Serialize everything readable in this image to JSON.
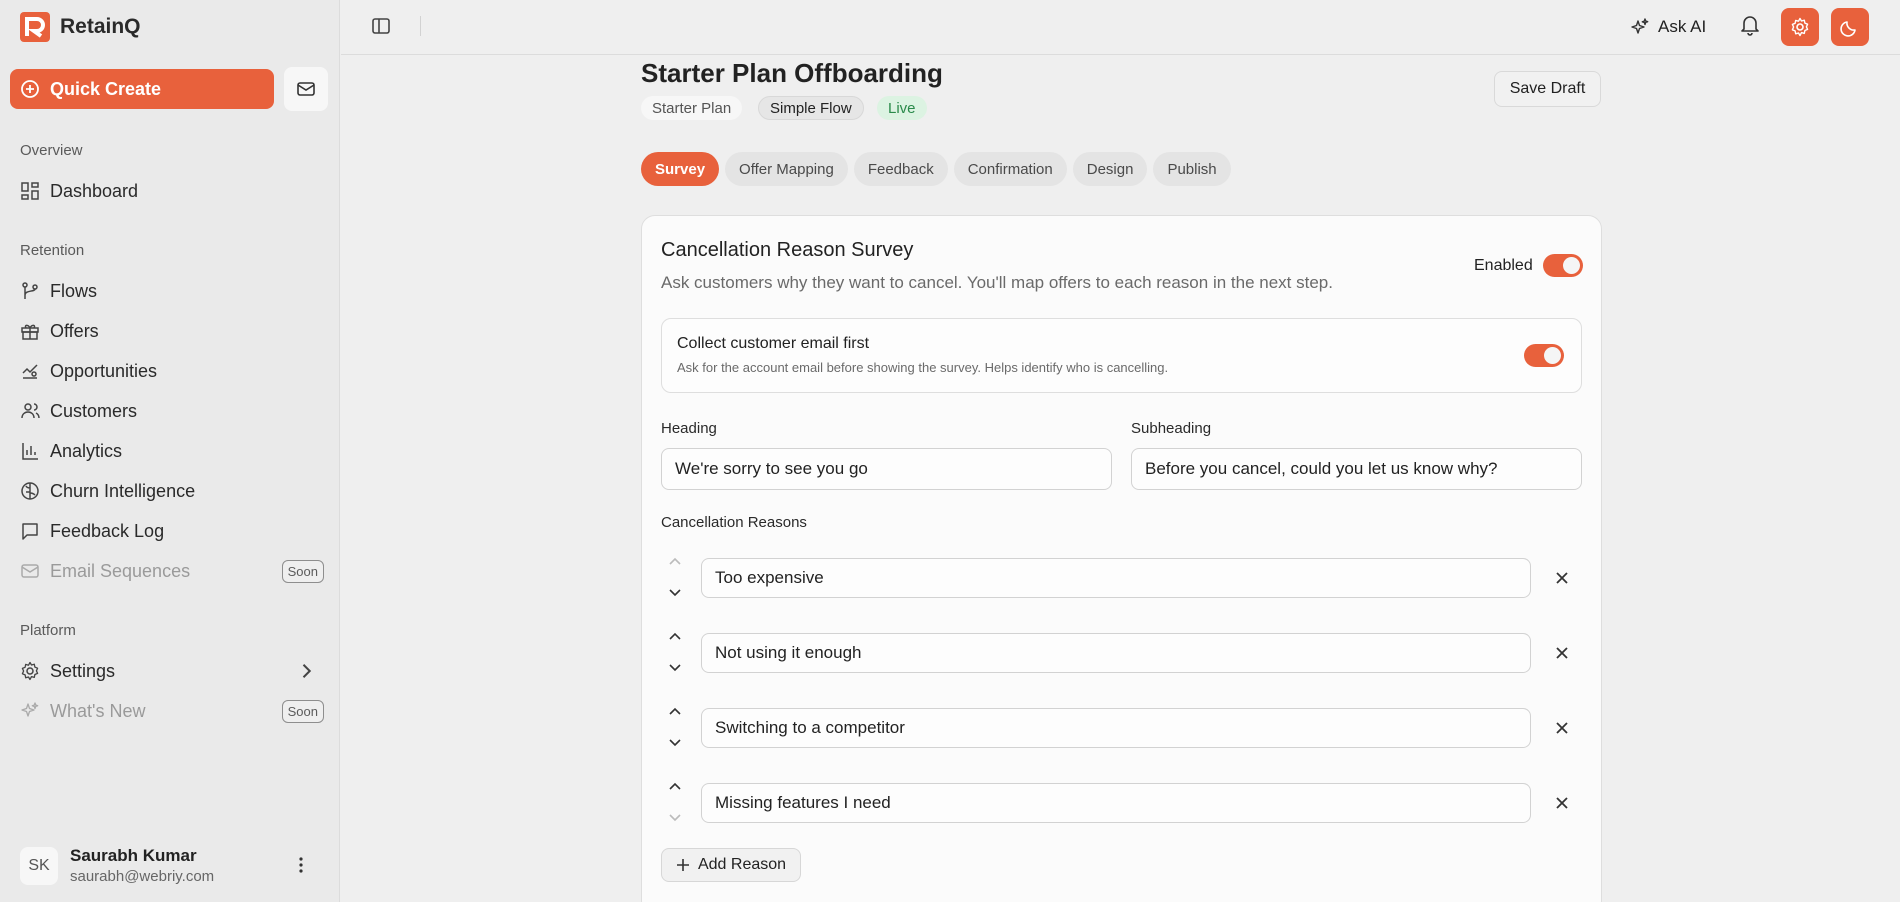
{
  "brand": {
    "name": "RetainQ",
    "accent": "#e8613c"
  },
  "sidebar": {
    "quick_create": "Quick Create",
    "sections": {
      "overview": "Overview",
      "retention": "Retention",
      "platform": "Platform"
    },
    "items": [
      {
        "label": "Dashboard",
        "icon": "dashboard-icon"
      },
      {
        "label": "Flows",
        "icon": "flows-icon"
      },
      {
        "label": "Offers",
        "icon": "gift-icon"
      },
      {
        "label": "Opportunities",
        "icon": "opportunities-icon"
      },
      {
        "label": "Customers",
        "icon": "users-icon"
      },
      {
        "label": "Analytics",
        "icon": "chart-icon"
      },
      {
        "label": "Churn Intelligence",
        "icon": "brain-icon"
      },
      {
        "label": "Feedback Log",
        "icon": "message-icon"
      },
      {
        "label": "Email Sequences",
        "icon": "mail-icon",
        "badge": "Soon"
      },
      {
        "label": "Settings",
        "icon": "gear-icon"
      },
      {
        "label": "What's New",
        "icon": "sparkle-icon",
        "badge": "Soon"
      }
    ],
    "user": {
      "initials": "SK",
      "name": "Saurabh Kumar",
      "email": "saurabh@webriy.com"
    }
  },
  "topbar": {
    "ask_ai": "Ask AI"
  },
  "page": {
    "title": "Starter Plan Offboarding",
    "tags": [
      "Starter Plan",
      "Simple Flow",
      "Live"
    ],
    "save_draft": "Save Draft",
    "tabs": [
      "Survey",
      "Offer Mapping",
      "Feedback",
      "Confirmation",
      "Design",
      "Publish"
    ],
    "active_tab": "Survey"
  },
  "survey": {
    "title": "Cancellation Reason Survey",
    "description": "Ask customers why they want to cancel. You'll map offers to each reason in the next step.",
    "enabled_label": "Enabled",
    "enabled": true,
    "collect_email": {
      "title": "Collect customer email first",
      "description": "Ask for the account email before showing the survey. Helps identify who is cancelling.",
      "enabled": true
    },
    "heading_label": "Heading",
    "heading_value": "We're sorry to see you go",
    "subheading_label": "Subheading",
    "subheading_value": "Before you cancel, could you let us know why?",
    "reasons_label": "Cancellation Reasons",
    "reasons": [
      "Too expensive",
      "Not using it enough",
      "Switching to a competitor",
      "Missing features I need"
    ],
    "add_reason": "Add Reason"
  }
}
